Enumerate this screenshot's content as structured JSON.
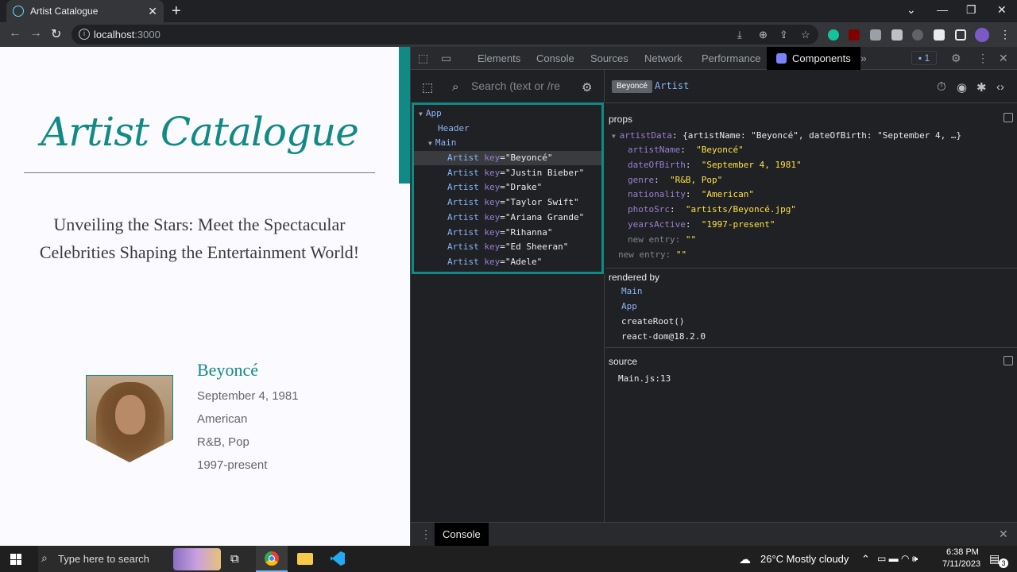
{
  "browser": {
    "tab_title": "Artist Catalogue",
    "url_host": "localhost",
    "url_port": ":3000"
  },
  "page": {
    "brand": "Artist Catalogue",
    "tagline": "Unveiling the Stars: Meet the Spectacular Celebrities Shaping the Entertainment World!",
    "artist": {
      "name": "Beyoncé",
      "birth": "September 4, 1981",
      "nationality": "American",
      "genre": "R&B, Pop",
      "active": "1997-present"
    }
  },
  "devtools": {
    "tabs": [
      "Elements",
      "Console",
      "Sources",
      "Network",
      "Performance",
      "Components"
    ],
    "issues_count": "1",
    "search_placeholder": "Search (text or /re",
    "tree": {
      "app": "App",
      "header": "Header",
      "main": "Main",
      "artist_label": "Artist",
      "key_label": "key",
      "artists": [
        "Beyoncé",
        "Justin Bieber",
        "Drake",
        "Taylor Swift",
        "Ariana Grande",
        "Rihanna",
        "Ed Sheeran",
        "Adele"
      ]
    },
    "breadcrumb": {
      "parent": "Beyoncé",
      "current": "Artist"
    },
    "props": {
      "title": "props",
      "summary_key": "artistData",
      "summary_value": "{artistName: \"Beyoncé\", dateOfBirth: \"September 4, …}",
      "fields": [
        {
          "key": "artistName",
          "value": "\"Beyoncé\""
        },
        {
          "key": "dateOfBirth",
          "value": "\"September 4, 1981\""
        },
        {
          "key": "genre",
          "value": "\"R&B, Pop\""
        },
        {
          "key": "nationality",
          "value": "\"American\""
        },
        {
          "key": "photoSrc",
          "value": "\"artists/Beyoncé.jpg\""
        },
        {
          "key": "yearsActive",
          "value": "\"1997-present\""
        }
      ],
      "new_entry_label": "new entry",
      "new_entry_value": "\"\""
    },
    "rendered_by": {
      "title": "rendered by",
      "items": [
        "Main",
        "App",
        "createRoot()",
        "react-dom@18.2.0"
      ]
    },
    "source": {
      "title": "source",
      "file": "Main.js:13"
    },
    "drawer_tab": "Console"
  },
  "taskbar": {
    "search_placeholder": "Type here to search",
    "weather": "26°C  Mostly cloudy",
    "time": "6:38 PM",
    "date": "7/11/2023",
    "notifications": "3"
  }
}
